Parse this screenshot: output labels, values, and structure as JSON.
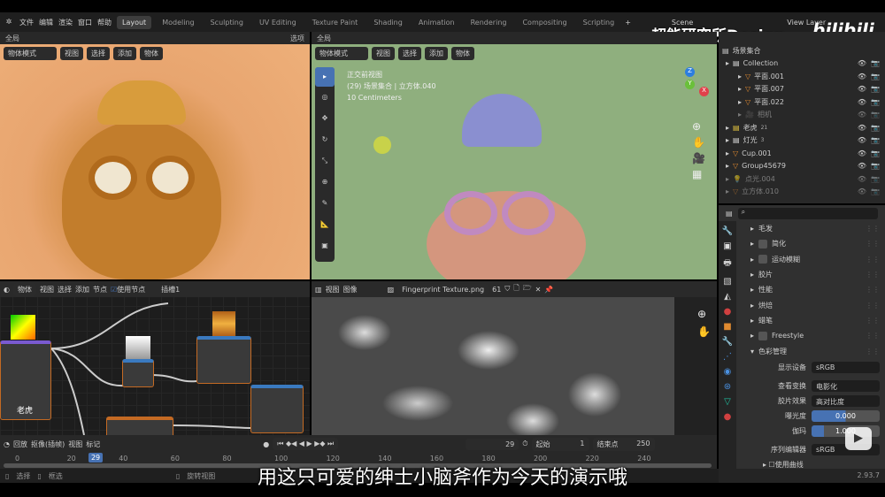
{
  "topbar": {
    "menu": [
      "文件",
      "编辑",
      "渲染",
      "窗口",
      "帮助"
    ],
    "workspaces": [
      "Layout",
      "Modeling",
      "Sculpting",
      "UV Editing",
      "Texture Paint",
      "Shading",
      "Animation",
      "Rendering",
      "Compositing",
      "Scripting"
    ],
    "active_workspace": "Layout",
    "scene": "Scene",
    "view_layer": "View Layer",
    "add_tab": "+"
  },
  "watermark": {
    "channel": "超能研究所Design",
    "logo": "bilibili"
  },
  "left_viewport": {
    "transform": "全局",
    "options": "选项",
    "mode": "物体模式",
    "menus": [
      "视图",
      "选择",
      "添加",
      "物体"
    ]
  },
  "center_viewport": {
    "transform": "全局",
    "mode": "物体模式",
    "menus": [
      "视图",
      "选择",
      "添加",
      "物体"
    ],
    "overlay_lines": [
      "正交前视图",
      "(29) 场景集合 | 立方体.040",
      "10 Centimeters"
    ],
    "gizmo": {
      "x": "X",
      "y": "Y",
      "z": "Z"
    }
  },
  "outliner": {
    "root": "场景集合",
    "items": [
      {
        "name": "Collection",
        "level": 0,
        "type": "collection"
      },
      {
        "name": "平面.001",
        "level": 1,
        "type": "mesh"
      },
      {
        "name": "平面.007",
        "level": 1,
        "type": "mesh"
      },
      {
        "name": "平面.022",
        "level": 1,
        "type": "mesh"
      },
      {
        "name": "相机",
        "level": 1,
        "type": "camera",
        "dim": true
      },
      {
        "name": "老虎",
        "level": 0,
        "type": "collection-yellow",
        "badge": "21"
      },
      {
        "name": "灯光",
        "level": 0,
        "type": "collection",
        "badge": "3"
      },
      {
        "name": "Cup.001",
        "level": 0,
        "type": "mesh"
      },
      {
        "name": "Group45679",
        "level": 0,
        "type": "mesh"
      },
      {
        "name": "点光.004",
        "level": 0,
        "type": "light",
        "dim": true
      },
      {
        "name": "立方体.010",
        "level": 0,
        "type": "mesh",
        "dim": true
      }
    ]
  },
  "properties": {
    "search_placeholder": "",
    "panels": [
      {
        "label": "毛发",
        "checkbox": false
      },
      {
        "label": "简化",
        "checkbox": true
      },
      {
        "label": "运动模糊",
        "checkbox": true
      },
      {
        "label": "胶片",
        "checkbox": false
      },
      {
        "label": "性能",
        "checkbox": false
      },
      {
        "label": "烘焙",
        "checkbox": false
      },
      {
        "label": "蜡笔",
        "checkbox": false
      },
      {
        "label": "Freestyle",
        "checkbox": true
      },
      {
        "label": "色彩管理",
        "checkbox": false,
        "open": true
      }
    ],
    "color_management": {
      "display_device_label": "显示设备",
      "display_device": "sRGB",
      "view_transform_label": "查看变换",
      "view_transform": "电影化",
      "look_label": "胶片效果",
      "look": "高对比度",
      "exposure_label": "曝光度",
      "exposure": "0.000",
      "gamma_label": "伽玛",
      "gamma": "1.000",
      "sequencer_label": "序列编辑器",
      "sequencer": "sRGB",
      "curves_label": "使用曲线"
    },
    "version": "2.93.7"
  },
  "node_editor": {
    "type": "物体",
    "menus": [
      "视图",
      "选择",
      "添加",
      "节点"
    ],
    "use_nodes": "使用节点",
    "slot": "插槽1",
    "node_label": "老虎"
  },
  "image_editor": {
    "menus": [
      "视图",
      "图像"
    ],
    "image_name": "Fingerprint Texture.png",
    "users": "61"
  },
  "timeline": {
    "playback": "回放",
    "keying": "抠像(插帧)",
    "menus": [
      "视图",
      "标记"
    ],
    "current_frame": "29",
    "start_label": "起始",
    "start": "1",
    "end_label": "结束点",
    "end": "250",
    "ticks": [
      "0",
      "20",
      "40",
      "60",
      "80",
      "100",
      "120",
      "140",
      "160",
      "180",
      "200",
      "220",
      "240"
    ]
  },
  "statusbar": {
    "select": "选择",
    "box_select": "框选",
    "rotate_view": "旋转视图"
  },
  "subtitle": "用这只可爱的绅士小脑斧作为今天的演示哦",
  "colors": {
    "accent": "#4772b3",
    "viewport_left": "#e8a56f",
    "viewport_center": "#8faf7e",
    "active_frame": "#4772b3"
  }
}
